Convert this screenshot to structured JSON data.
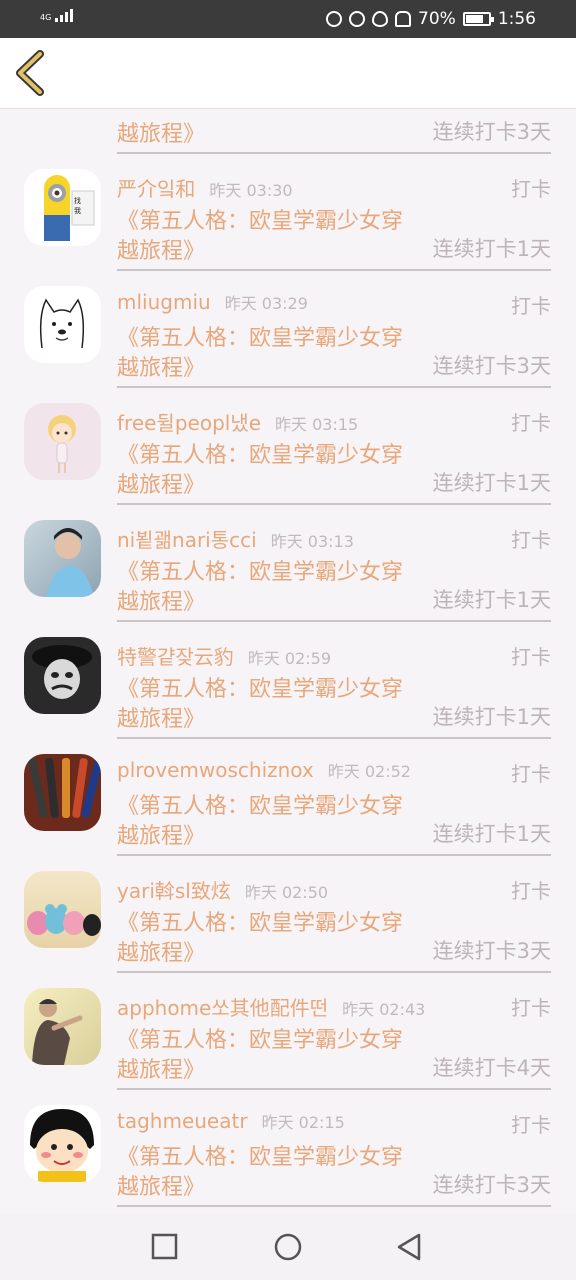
{
  "status_bar": {
    "network": "4G",
    "battery_percent": "70%",
    "time": "1:56"
  },
  "header": {
    "back_icon": "chevron-left-icon",
    "accent_color": "#e0c06a"
  },
  "list": {
    "top_partial": {
      "title_line1": "《第五人格：欧皇学霸少女穿",
      "title_line2": "越旅程》",
      "streak": "连续打卡3天"
    },
    "items": [
      {
        "username": "严介잌和",
        "time": "昨天 03:30",
        "checkin": "打卡",
        "title_line1": "《第五人格：欧皇学霸少女穿",
        "title_line2": "越旅程》",
        "streak": "连续打卡1天",
        "avatar": "minion"
      },
      {
        "username": "mliugmiu",
        "time": "昨天 03:29",
        "checkin": "打卡",
        "title_line1": "《第五人格：欧皇学霸少女穿",
        "title_line2": "越旅程》",
        "streak": "连续打卡3天",
        "avatar": "dog-sketch"
      },
      {
        "username": "free뒬peopl냈e",
        "time": "昨天 03:15",
        "checkin": "打卡",
        "title_line1": "《第五人格：欧皇学霸少女穿",
        "title_line2": "越旅程》",
        "streak": "连续打卡1天",
        "avatar": "cartoon-girl"
      },
      {
        "username": "ni뵡괢nari통cci",
        "time": "昨天 03:13",
        "checkin": "打卡",
        "title_line1": "《第五人格：欧皇学霸少女穿",
        "title_line2": "越旅程》",
        "streak": "连续打卡1天",
        "avatar": "boy-photo"
      },
      {
        "username": "特警걑잦云豹",
        "time": "昨天 02:59",
        "checkin": "打卡",
        "title_line1": "《第五人格：欧皇学霸少女穿",
        "title_line2": "越旅程》",
        "streak": "连续打卡1天",
        "avatar": "clown-bw"
      },
      {
        "username": "plrovemwoschiznox",
        "time": "昨天 02:52",
        "checkin": "打卡",
        "title_line1": "《第五人格：欧皇学霸少女穿",
        "title_line2": "越旅程》",
        "streak": "连续打卡1天",
        "avatar": "pens"
      },
      {
        "username": "yari斡sl致炫",
        "time": "昨天 02:50",
        "checkin": "打卡",
        "title_line1": "《第五人格：欧皇学霸少女穿",
        "title_line2": "越旅程》",
        "streak": "连续打卡3天",
        "avatar": "toys"
      },
      {
        "username": "apphome쏘其他配件떤",
        "time": "昨天 02:43",
        "checkin": "打卡",
        "title_line1": "《第五人格：欧皇学霸少女穿",
        "title_line2": "越旅程》",
        "streak": "连续打卡4天",
        "avatar": "man-photo"
      },
      {
        "username": "taghmeueatr",
        "time": "昨天 02:15",
        "checkin": "打卡",
        "title_line1": "《第五人格：欧皇学霸少女穿",
        "title_line2": "越旅程》",
        "streak": "连续打卡3天",
        "avatar": "cartoon-face"
      }
    ]
  },
  "nav_bar": {
    "recent_icon": "square-icon",
    "home_icon": "circle-icon",
    "back_icon": "triangle-back-icon"
  }
}
